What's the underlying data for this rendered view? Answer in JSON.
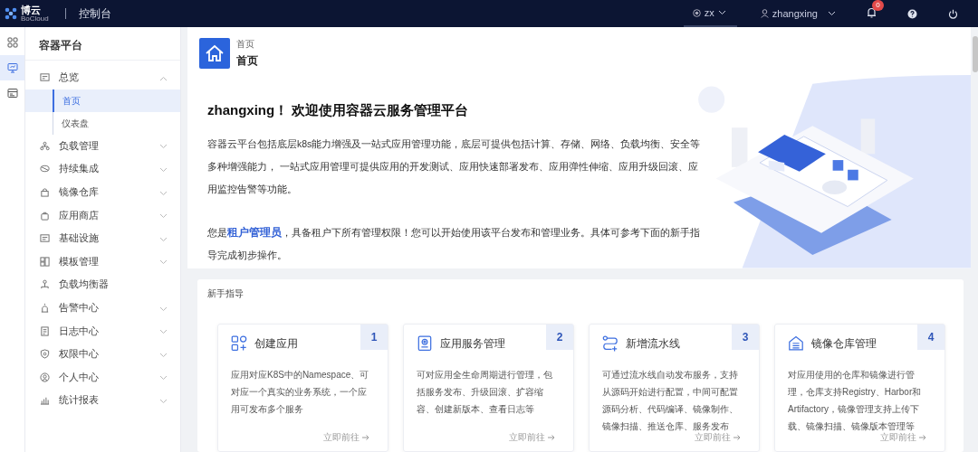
{
  "topbar": {
    "brand": "博云",
    "brand_sub": "BoCloud",
    "title": "控制台",
    "tenant": "zx",
    "user": "zhangxing",
    "notifications": "0"
  },
  "rail": [
    {
      "selected": false
    },
    {
      "selected": true
    },
    {
      "selected": false
    }
  ],
  "sidebar": {
    "title": "容器平台",
    "items": [
      {
        "label": "总览",
        "expandable": true,
        "expanded": true,
        "children": [
          {
            "label": "首页",
            "selected": true
          },
          {
            "label": "仪表盘",
            "selected": false
          }
        ]
      },
      {
        "label": "负载管理",
        "expandable": true,
        "expanded": false
      },
      {
        "label": "持续集成",
        "expandable": true,
        "expanded": false
      },
      {
        "label": "镜像仓库",
        "expandable": true,
        "expanded": false
      },
      {
        "label": "应用商店",
        "expandable": true,
        "expanded": false
      },
      {
        "label": "基础设施",
        "expandable": true,
        "expanded": false
      },
      {
        "label": "模板管理",
        "expandable": true,
        "expanded": false
      },
      {
        "label": "负载均衡器",
        "expandable": false
      },
      {
        "label": "告警中心",
        "expandable": true,
        "expanded": false
      },
      {
        "label": "日志中心",
        "expandable": true,
        "expanded": false
      },
      {
        "label": "权限中心",
        "expandable": true,
        "expanded": false
      },
      {
        "label": "个人中心",
        "expandable": true,
        "expanded": false
      },
      {
        "label": "统计报表",
        "expandable": true,
        "expanded": false
      }
    ]
  },
  "page_header": {
    "breadcrumb": "首页",
    "title": "首页"
  },
  "welcome": {
    "title": "zhangxing！ 欢迎使用容器云服务管理平台",
    "intro": "容器云平台包括底层k8s能力增强及一站式应用管理功能，底层可提供包括计算、存储、网络、负载均衡、安全等多种增强能力， 一站式应用管理可提供应用的开发测试、应用快速部署发布、应用弹性伸缩、应用升级回滚、应用监控告警等功能。",
    "role": "您是**租户管理员**，具备租户下所有管理权限！您可以开始使用该平台发布和管理业务。具体可参考下面的新手指导完成初步操作。"
  },
  "guide": {
    "title": "新手指导",
    "cards": [
      {
        "number": "1",
        "title": "创建应用",
        "description": "应用对应K8S中的Namespace、可对应一个真实的业务系统，一个应用可发布多个服务",
        "link": "立即前往"
      },
      {
        "number": "2",
        "title": "应用服务管理",
        "description": "可对应用全生命周期进行管理，包括服务发布、升级回滚、扩容缩容、创建新版本、查看日志等",
        "link": "立即前往"
      },
      {
        "number": "3",
        "title": "新增流水线",
        "description": "可通过流水线自动发布服务，支持从源码开始进行配置，中间可配置源码分析、代码编译、镜像制作、镜像扫描、推送仓库、服务发布",
        "link": "立即前往"
      },
      {
        "number": "4",
        "title": "镜像仓库管理",
        "description": "对应用使用的仓库和镜像进行管理，仓库支持Registry、Harbor和Artifactory，镜像管理支持上传下载、镜像扫描、镜像版本管理等",
        "link": "立即前往"
      }
    ]
  }
}
